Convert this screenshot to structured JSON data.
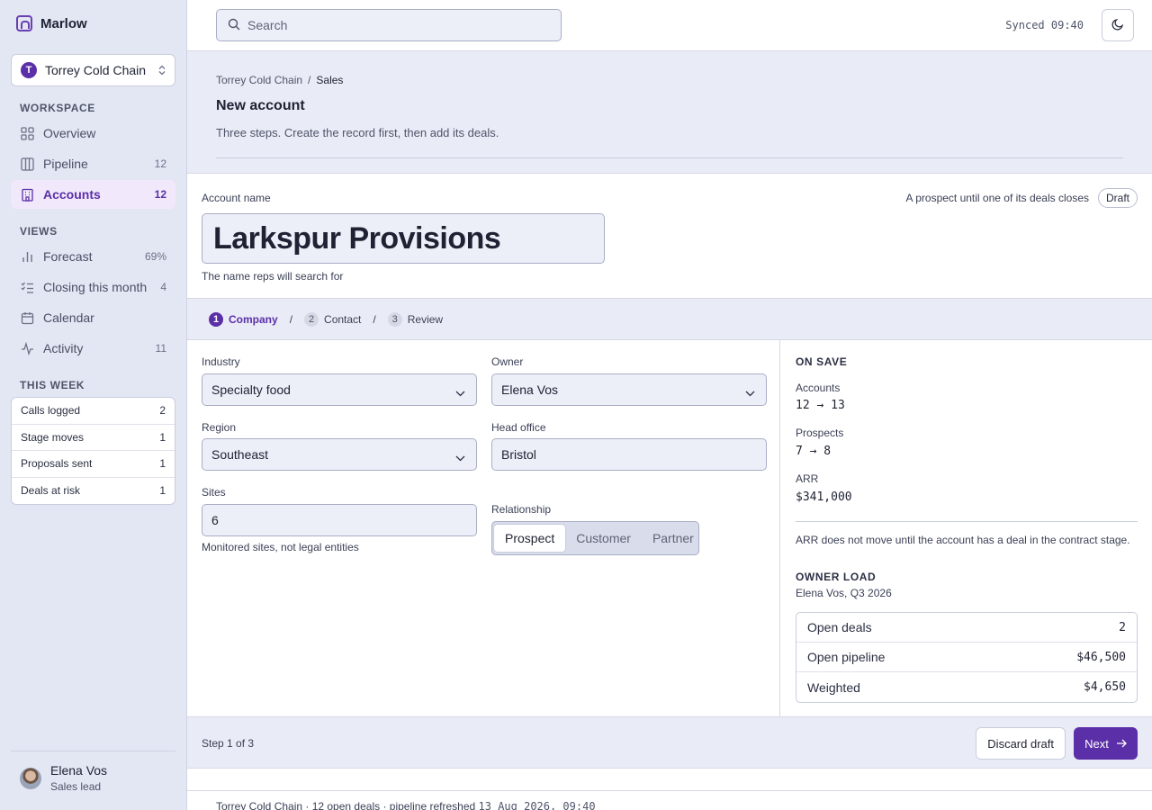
{
  "app": {
    "name": "Marlow"
  },
  "org_switcher": {
    "initial": "T",
    "name": "Torrey Cold Chain"
  },
  "sidebar": {
    "workspace_title": "WORKSPACE",
    "workspace": [
      {
        "label": "Overview",
        "count": "",
        "icon": "grid-icon"
      },
      {
        "label": "Pipeline",
        "count": "12",
        "icon": "columns-icon"
      },
      {
        "label": "Accounts",
        "count": "12",
        "icon": "building-icon",
        "active": true
      }
    ],
    "views_title": "VIEWS",
    "views": [
      {
        "label": "Forecast",
        "count": "69%",
        "icon": "bar-chart-icon"
      },
      {
        "label": "Closing this month",
        "count": "4",
        "icon": "checklist-icon"
      },
      {
        "label": "Calendar",
        "count": "",
        "icon": "calendar-icon"
      },
      {
        "label": "Activity",
        "count": "11",
        "icon": "activity-icon"
      }
    ],
    "week_title": "THIS WEEK",
    "week": [
      {
        "label": "Calls logged",
        "value": "2"
      },
      {
        "label": "Stage moves",
        "value": "1"
      },
      {
        "label": "Proposals sent",
        "value": "1"
      },
      {
        "label": "Deals at risk",
        "value": "1"
      }
    ],
    "user": {
      "name": "Elena Vos",
      "role": "Sales lead"
    }
  },
  "topbar": {
    "search_placeholder": "Search",
    "synced": "Synced 09:40"
  },
  "header": {
    "breadcrumb": [
      "Torrey Cold Chain",
      "Sales"
    ],
    "title": "New account",
    "subtitle": "Three steps. Create the record first, then add its deals."
  },
  "name_section": {
    "label": "Account name",
    "value": "Larkspur Provisions",
    "help": "The name reps will search for",
    "note": "A prospect until one of its deals closes",
    "badge": "Draft"
  },
  "steps": [
    {
      "num": "1",
      "label": "Company",
      "active": true
    },
    {
      "num": "2",
      "label": "Contact"
    },
    {
      "num": "3",
      "label": "Review"
    }
  ],
  "form": {
    "industry": {
      "label": "Industry",
      "value": "Specialty food"
    },
    "owner": {
      "label": "Owner",
      "value": "Elena Vos"
    },
    "region": {
      "label": "Region",
      "value": "Southeast"
    },
    "head_office": {
      "label": "Head office",
      "value": "Bristol"
    },
    "sites": {
      "label": "Sites",
      "value": "6",
      "help": "Monitored sites, not legal entities"
    },
    "relationship": {
      "label": "Relationship",
      "options": [
        "Prospect",
        "Customer",
        "Partner"
      ],
      "selected": "Prospect"
    }
  },
  "on_save": {
    "title": "ON SAVE",
    "items": [
      {
        "label": "Accounts",
        "value": "12 → 13"
      },
      {
        "label": "Prospects",
        "value": "7 → 8"
      },
      {
        "label": "ARR",
        "value": "$341,000"
      }
    ],
    "note": "ARR does not move until the account has a deal in the contract stage."
  },
  "owner_load": {
    "title": "OWNER LOAD",
    "subtitle": "Elena Vos, Q3 2026",
    "rows": [
      {
        "label": "Open deals",
        "value": "2"
      },
      {
        "label": "Open pipeline",
        "value": "$46,500"
      },
      {
        "label": "Weighted",
        "value": "$4,650"
      }
    ]
  },
  "actions": {
    "step_count": "Step 1 of 3",
    "discard": "Discard draft",
    "next": "Next"
  },
  "footer": {
    "text": "Torrey Cold Chain · 12 open deals · pipeline refreshed",
    "timestamp": "13 Aug 2026, 09:40"
  }
}
